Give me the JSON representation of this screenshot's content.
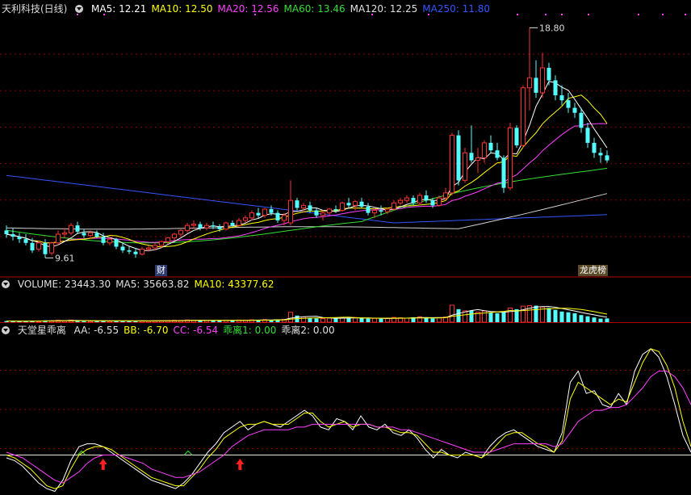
{
  "title": "天利科技(日线)",
  "price_panel": {
    "indicators": [
      {
        "label": "MA5: 12.21",
        "color": "#ffffff"
      },
      {
        "label": "MA10: 12.50",
        "color": "#ffff00"
      },
      {
        "label": "MA20: 12.56",
        "color": "#ff40ff"
      },
      {
        "label": "MA60: 13.46",
        "color": "#33e033"
      },
      {
        "label": "MA120: 12.25",
        "color": "#e0e0e0"
      },
      {
        "label": "MA250: 11.80",
        "color": "#3355ff"
      }
    ],
    "high_label": "18.80",
    "low_label": "9.61",
    "badge_cai": "财",
    "badge_lhb": "龙虎榜"
  },
  "volume_panel": {
    "indicators": [
      {
        "label": "VOLUME: 23443.30",
        "color": "#e0e0e0"
      },
      {
        "label": "MA5: 35663.82",
        "color": "#e0e0e0"
      },
      {
        "label": "MA10: 43377.62",
        "color": "#ffff00"
      }
    ]
  },
  "osc_panel": {
    "title": "天堂星乖离",
    "indicators": [
      {
        "label": "AA: -6.55",
        "color": "#e0e0e0"
      },
      {
        "label": "BB: -6.70",
        "color": "#ffff00"
      },
      {
        "label": "CC: -6.54",
        "color": "#ff40ff"
      },
      {
        "label": "乖离1: 0.00",
        "color": "#33e033"
      },
      {
        "label": "乖离2: 0.00",
        "color": "#e0e0e0"
      }
    ]
  },
  "chart_data": {
    "type": "candlestick",
    "y_range": [
      9.0,
      19.2
    ],
    "ohlc": [
      [
        10.7,
        10.9,
        10.4,
        10.55
      ],
      [
        10.55,
        10.8,
        10.3,
        10.45
      ],
      [
        10.45,
        10.6,
        10.2,
        10.35
      ],
      [
        10.35,
        10.55,
        10.1,
        10.2
      ],
      [
        10.2,
        10.4,
        9.8,
        9.9
      ],
      [
        9.95,
        10.3,
        9.85,
        10.2
      ],
      [
        10.2,
        10.35,
        9.6,
        9.75
      ],
      [
        9.8,
        10.25,
        9.7,
        10.2
      ],
      [
        10.2,
        10.7,
        10.1,
        10.55
      ],
      [
        10.55,
        10.8,
        10.4,
        10.6
      ],
      [
        10.6,
        11.0,
        10.5,
        10.9
      ],
      [
        10.9,
        11.05,
        10.55,
        10.65
      ],
      [
        10.6,
        10.75,
        10.4,
        10.5
      ],
      [
        10.5,
        10.7,
        10.35,
        10.6
      ],
      [
        10.6,
        10.7,
        10.4,
        10.45
      ],
      [
        10.45,
        10.6,
        10.1,
        10.2
      ],
      [
        10.2,
        10.45,
        10.1,
        10.35
      ],
      [
        10.35,
        10.4,
        9.95,
        10.05
      ],
      [
        10.05,
        10.2,
        9.8,
        9.9
      ],
      [
        9.9,
        10.05,
        9.75,
        9.85
      ],
      [
        9.85,
        10.0,
        9.61,
        9.75
      ],
      [
        9.75,
        10.05,
        9.7,
        9.95
      ],
      [
        9.95,
        10.1,
        9.85,
        10.0
      ],
      [
        10.0,
        10.2,
        9.9,
        10.1
      ],
      [
        10.1,
        10.3,
        10.0,
        10.25
      ],
      [
        10.25,
        10.45,
        10.15,
        10.4
      ],
      [
        10.4,
        10.6,
        10.3,
        10.55
      ],
      [
        10.55,
        10.75,
        10.45,
        10.7
      ],
      [
        10.7,
        11.0,
        10.6,
        10.9
      ],
      [
        10.9,
        11.1,
        10.75,
        10.95
      ],
      [
        10.95,
        11.05,
        10.7,
        10.8
      ],
      [
        10.8,
        11.0,
        10.7,
        10.9
      ],
      [
        10.9,
        11.05,
        10.75,
        10.85
      ],
      [
        10.85,
        10.95,
        10.65,
        10.75
      ],
      [
        10.75,
        11.05,
        10.7,
        11.0
      ],
      [
        11.0,
        11.1,
        10.85,
        10.9
      ],
      [
        10.9,
        11.2,
        10.85,
        11.1
      ],
      [
        11.1,
        11.3,
        11.0,
        11.2
      ],
      [
        11.2,
        11.5,
        11.1,
        11.4
      ],
      [
        11.4,
        11.6,
        11.2,
        11.3
      ],
      [
        11.3,
        11.6,
        11.2,
        11.55
      ],
      [
        11.55,
        11.7,
        11.3,
        11.4
      ],
      [
        11.4,
        11.5,
        11.0,
        11.1
      ],
      [
        11.1,
        11.4,
        10.9,
        11.3
      ],
      [
        11.0,
        12.7,
        10.9,
        11.9
      ],
      [
        11.9,
        12.0,
        11.5,
        11.6
      ],
      [
        11.6,
        11.8,
        11.4,
        11.7
      ],
      [
        11.7,
        11.85,
        11.4,
        11.5
      ],
      [
        11.5,
        11.6,
        11.2,
        11.3
      ],
      [
        11.3,
        11.5,
        11.1,
        11.4
      ],
      [
        11.4,
        11.6,
        11.3,
        11.55
      ],
      [
        11.55,
        11.7,
        11.4,
        11.5
      ],
      [
        11.5,
        11.85,
        11.45,
        11.8
      ],
      [
        11.8,
        12.0,
        11.6,
        11.7
      ],
      [
        11.7,
        11.9,
        11.5,
        11.85
      ],
      [
        11.85,
        12.0,
        11.6,
        11.65
      ],
      [
        11.65,
        11.8,
        11.3,
        11.4
      ],
      [
        11.4,
        11.6,
        11.2,
        11.5
      ],
      [
        11.5,
        11.7,
        11.3,
        11.45
      ],
      [
        11.45,
        11.6,
        11.35,
        11.55
      ],
      [
        11.55,
        11.9,
        11.5,
        11.8
      ],
      [
        11.8,
        12.0,
        11.7,
        11.9
      ],
      [
        11.9,
        12.1,
        11.8,
        12.0
      ],
      [
        12.0,
        12.1,
        11.7,
        11.8
      ],
      [
        11.8,
        12.2,
        11.7,
        12.1
      ],
      [
        12.1,
        12.3,
        11.8,
        11.9
      ],
      [
        11.9,
        12.0,
        11.6,
        11.7
      ],
      [
        11.7,
        12.1,
        11.65,
        12.0
      ],
      [
        12.0,
        12.4,
        11.9,
        12.2
      ],
      [
        12.2,
        14.6,
        12.1,
        14.5
      ],
      [
        14.5,
        14.7,
        12.5,
        12.7
      ],
      [
        12.7,
        14.0,
        12.6,
        13.8
      ],
      [
        13.8,
        14.9,
        13.4,
        13.5
      ],
      [
        13.5,
        14.0,
        13.0,
        13.6
      ],
      [
        13.6,
        14.3,
        13.4,
        14.2
      ],
      [
        14.2,
        14.5,
        13.8,
        13.9
      ],
      [
        13.9,
        14.2,
        13.5,
        13.6
      ],
      [
        13.6,
        13.7,
        12.2,
        12.4
      ],
      [
        12.4,
        15.0,
        12.3,
        14.8
      ],
      [
        14.8,
        14.9,
        14.0,
        14.1
      ],
      [
        14.1,
        16.5,
        14.0,
        16.4
      ],
      [
        16.4,
        18.8,
        15.5,
        16.8
      ],
      [
        16.8,
        17.5,
        16.0,
        16.2
      ],
      [
        16.2,
        17.8,
        16.0,
        17.2
      ],
      [
        17.2,
        17.4,
        16.5,
        16.7
      ],
      [
        16.7,
        16.9,
        15.9,
        16.1
      ],
      [
        16.1,
        16.5,
        15.7,
        15.9
      ],
      [
        15.9,
        16.2,
        15.4,
        15.6
      ],
      [
        15.6,
        15.8,
        15.2,
        15.4
      ],
      [
        15.4,
        15.6,
        14.6,
        14.8
      ],
      [
        14.8,
        15.0,
        14.0,
        14.2
      ],
      [
        14.2,
        14.4,
        13.6,
        13.8
      ],
      [
        13.8,
        14.0,
        13.4,
        13.7
      ],
      [
        13.7,
        13.9,
        13.4,
        13.5
      ]
    ],
    "volume_range": [
      0,
      140000
    ],
    "volume": [
      5000,
      4500,
      4000,
      4200,
      6500,
      4500,
      7500,
      6000,
      8000,
      6500,
      9000,
      6000,
      5000,
      4500,
      5500,
      6000,
      4800,
      6000,
      5500,
      5000,
      6500,
      5800,
      5000,
      6000,
      6500,
      7000,
      8000,
      7500,
      9500,
      8500,
      7000,
      7500,
      7000,
      6800,
      8500,
      7000,
      9000,
      8800,
      10000,
      9500,
      11000,
      9000,
      11500,
      12000,
      42000,
      28000,
      22000,
      18000,
      16000,
      15000,
      18000,
      16000,
      20000,
      18000,
      20000,
      17000,
      15000,
      16000,
      14500,
      15500,
      20000,
      18500,
      17000,
      21000,
      23000,
      18000,
      16000,
      19000,
      22000,
      72000,
      55000,
      48000,
      50000,
      42000,
      47000,
      40000,
      38000,
      42000,
      60000,
      55000,
      68000,
      70000,
      70000,
      64000,
      60000,
      52000,
      45000,
      42000,
      38000,
      30000,
      25000,
      20000,
      15000,
      16000
    ],
    "oscillator_range": [
      -14,
      42
    ],
    "oscillator": [
      {
        "name": "AA",
        "color": "#ffffff",
        "values": [
          -1,
          -2,
          -4,
          -7,
          -10,
          -12,
          -13,
          -9,
          -2,
          3,
          4,
          4,
          3,
          1,
          -1,
          -3,
          -5,
          -7,
          -9,
          -10,
          -11,
          -12,
          -10,
          -7,
          -3,
          1,
          4,
          8,
          10,
          12,
          9,
          11,
          12,
          11,
          10,
          12,
          14,
          16,
          14,
          10,
          9,
          13,
          12,
          9,
          14,
          10,
          9,
          11,
          8,
          7,
          9,
          6,
          2,
          -1,
          2,
          0,
          -1,
          1,
          0,
          -1,
          3,
          6,
          8,
          9,
          7,
          5,
          3,
          2,
          1,
          8,
          26,
          30,
          22,
          23,
          18,
          17,
          22,
          18,
          30,
          36,
          38,
          35,
          28,
          18,
          7,
          1
        ]
      },
      {
        "name": "BB",
        "color": "#ffff00",
        "values": [
          0,
          -1,
          -3,
          -5,
          -8,
          -11,
          -12,
          -11,
          -5,
          0,
          2,
          3,
          3,
          2,
          0,
          -2,
          -4,
          -6,
          -8,
          -9,
          -10,
          -11,
          -11,
          -8,
          -5,
          -1,
          2,
          6,
          8,
          10,
          11,
          11,
          12,
          11,
          11,
          11,
          13,
          15,
          15,
          12,
          10,
          11,
          12,
          10,
          11,
          11,
          10,
          10,
          9,
          8,
          8,
          7,
          4,
          1,
          1,
          0,
          0,
          0,
          0,
          -1,
          1,
          4,
          7,
          8,
          8,
          6,
          4,
          3,
          1,
          5,
          20,
          26,
          24,
          22,
          20,
          18,
          20,
          19,
          26,
          33,
          38,
          37,
          32,
          24,
          12,
          3
        ]
      },
      {
        "name": "CC",
        "color": "#ff40ff",
        "values": [
          1,
          0,
          -1,
          -3,
          -5,
          -7,
          -9,
          -10,
          -8,
          -6,
          -3,
          -1,
          0,
          0,
          0,
          -1,
          -2,
          -3,
          -5,
          -6,
          -7,
          -8,
          -8,
          -7,
          -6,
          -4,
          -2,
          0,
          3,
          5,
          7,
          8,
          9,
          9,
          9,
          9,
          10,
          10,
          11,
          11,
          11,
          11,
          11,
          11,
          11,
          11,
          10,
          10,
          10,
          9,
          9,
          8,
          7,
          6,
          5,
          4,
          3,
          2,
          1,
          1,
          1,
          2,
          3,
          4,
          4,
          4,
          4,
          4,
          3,
          4,
          8,
          12,
          14,
          16,
          16,
          17,
          17,
          18,
          21,
          24,
          28,
          30,
          30,
          28,
          24,
          18
        ]
      }
    ],
    "arrows_up_at": [
      12,
      29
    ]
  }
}
